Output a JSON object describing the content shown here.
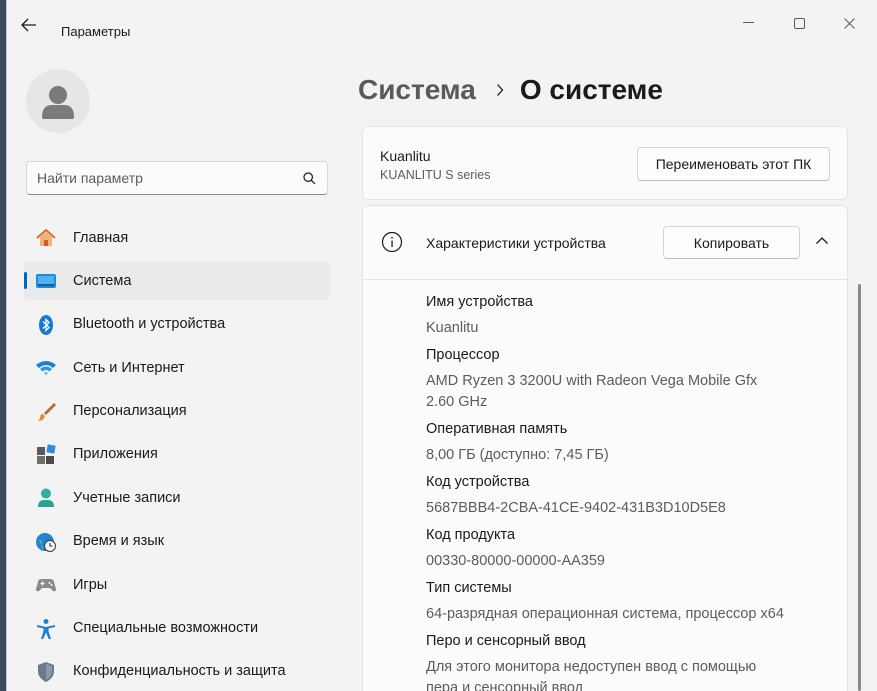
{
  "window": {
    "title": "Параметры"
  },
  "search": {
    "placeholder": "Найти параметр"
  },
  "sidebar": {
    "items": [
      {
        "label": "Главная",
        "icon": "home-icon"
      },
      {
        "label": "Система",
        "icon": "system-icon",
        "active": true
      },
      {
        "label": "Bluetooth и устройства",
        "icon": "bluetooth-icon"
      },
      {
        "label": "Сеть и Интернет",
        "icon": "wifi-icon"
      },
      {
        "label": "Персонализация",
        "icon": "brush-icon"
      },
      {
        "label": "Приложения",
        "icon": "apps-icon"
      },
      {
        "label": "Учетные записи",
        "icon": "account-icon"
      },
      {
        "label": "Время и язык",
        "icon": "globe-clock-icon"
      },
      {
        "label": "Игры",
        "icon": "gamepad-icon"
      },
      {
        "label": "Специальные возможности",
        "icon": "accessibility-icon"
      },
      {
        "label": "Конфиденциальность и защита",
        "icon": "shield-icon"
      }
    ]
  },
  "breadcrumb": {
    "parent": "Система",
    "current": "О системе"
  },
  "device_card": {
    "name": "Kuanlitu",
    "model": "KUANLITU S series",
    "rename_label": "Переименовать этот ПК"
  },
  "specs": {
    "title": "Характеристики устройства",
    "copy_label": "Копировать",
    "rows": [
      {
        "label": "Имя устройства",
        "value": "Kuanlitu"
      },
      {
        "label": "Процессор",
        "value": "AMD Ryzen 3 3200U with Radeon Vega Mobile Gfx\n2.60 GHz"
      },
      {
        "label": "Оперативная память",
        "value": "8,00 ГБ (доступно: 7,45 ГБ)"
      },
      {
        "label": "Код устройства",
        "value": "5687BBB4-2CBA-41CE-9402-431B3D10D5E8"
      },
      {
        "label": "Код продукта",
        "value": "00330-80000-00000-AA359"
      },
      {
        "label": "Тип системы",
        "value": "64-разрядная операционная система, процессор x64"
      },
      {
        "label": "Перо и сенсорный ввод",
        "value": "Для этого монитора недоступен ввод с помощью\nпера и сенсорный ввод"
      }
    ]
  },
  "colors": {
    "accent": "#0067c0",
    "window_bg": "#f3f3f3",
    "card_bg": "#fbfbfb"
  }
}
